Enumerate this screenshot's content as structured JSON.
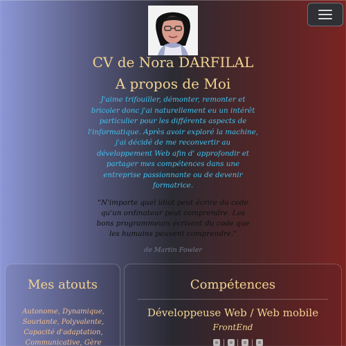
{
  "header": {
    "menu_icon": "hamburger-menu-icon"
  },
  "profile": {
    "photo_icon": "profile-photo-icon",
    "cv_title": "CV de Nora DARFILAL",
    "about_title": "A propos de Moi",
    "about_text": "J'aime trifouiller, démonter, remonter et bricoler donc j'ai naturellement eu un intérêt particulier pour les différents aspects de l'informatique. Après avoir exploré la machine, j'ai décidé de me reconvertir au développement Web afin d' approfondir et partager mes compétences dans une entreprise passionnante ou de devenir formatrice.",
    "quote": "\"N'importe quel idiot peut écrire du code qu'un ordinateur peut comprendre. Les bons programmeurs écrivent du code que les humains peuvent comprendre.\"",
    "quote_author": "de Martin Fowler"
  },
  "cards": {
    "assets": {
      "title": "Mes atouts",
      "text": "Autonome, Dynamique, Souriante, Polyvalente, Capacité d'adaptation, Communicative, Gère"
    },
    "skills": {
      "title": "Compétences",
      "role": "Développeuse Web / Web mobile",
      "frontend": "FrontEnd",
      "icons": [
        "html-icon",
        "css-icon",
        "javascript-icon",
        "php-icon"
      ]
    }
  },
  "colors": {
    "accent": "#f3d391",
    "about": "#42c2f0",
    "quote": "#111111",
    "author": "#72768a",
    "assets_text": "#f3be8f"
  }
}
